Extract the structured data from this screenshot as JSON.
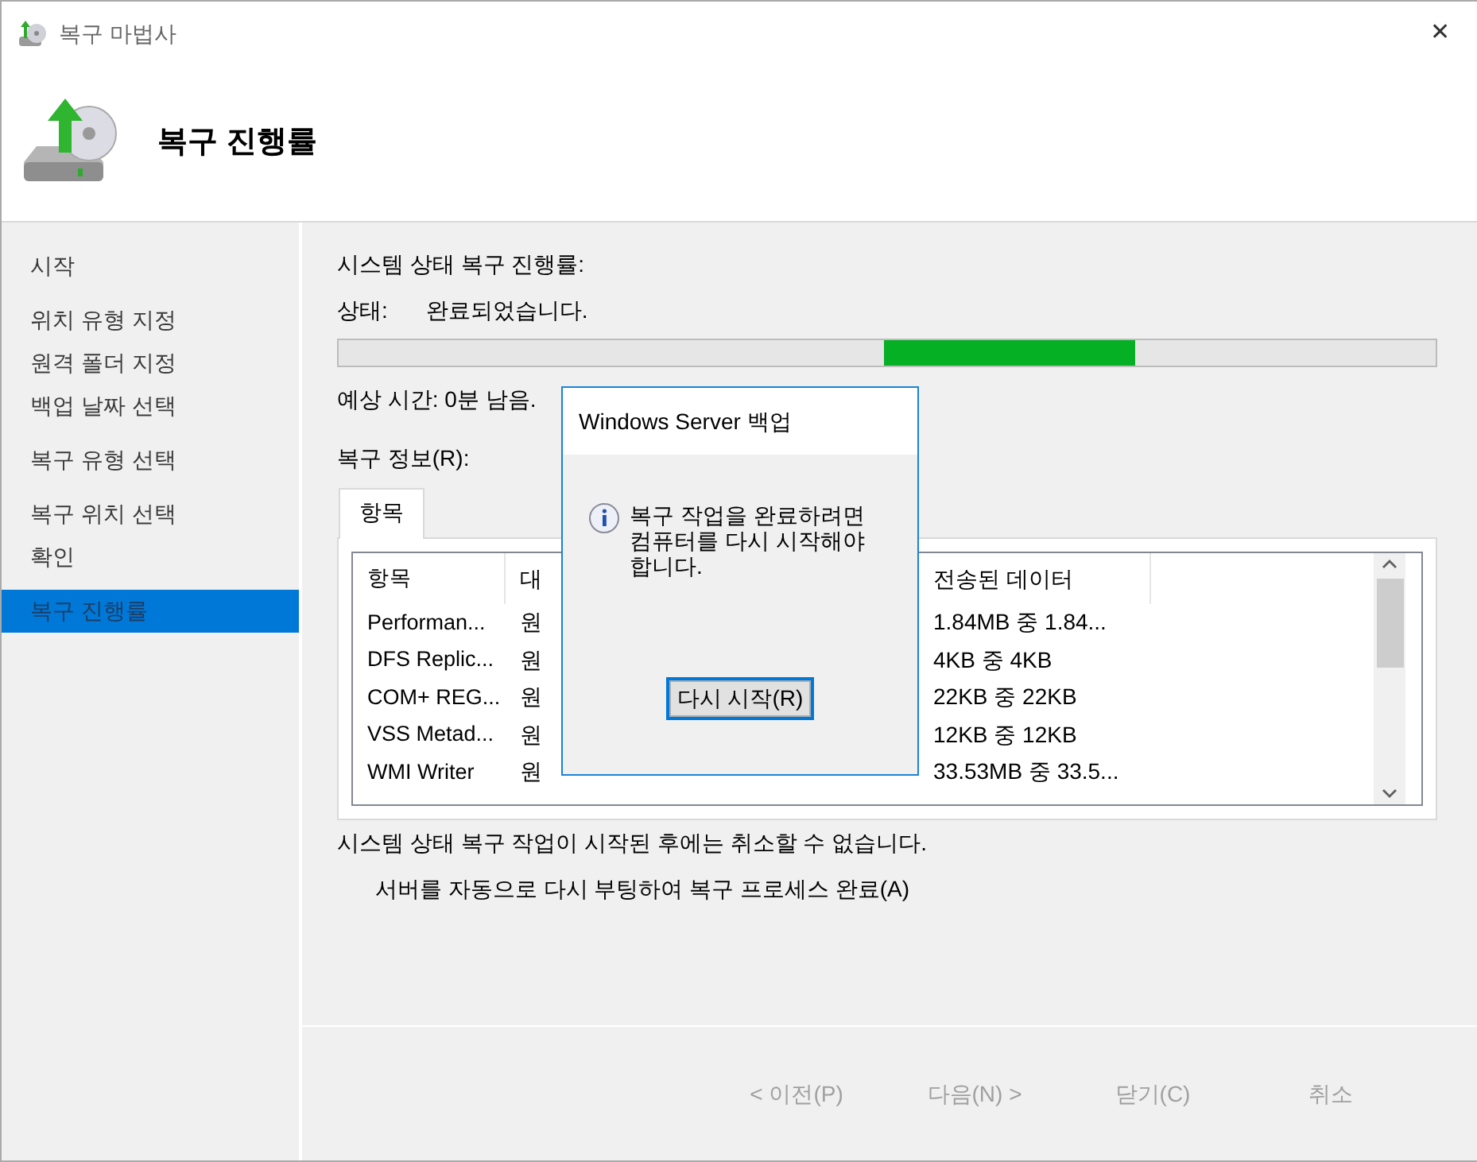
{
  "window": {
    "title": "복구 마법사",
    "close": "✕"
  },
  "header": {
    "title": "복구 진행률"
  },
  "sidebar": {
    "items": [
      {
        "label": "시작",
        "selected": false
      },
      {
        "label": "위치 유형 지정",
        "selected": false
      },
      {
        "label": "원격 폴더 지정",
        "selected": false
      },
      {
        "label": "백업 날짜 선택",
        "selected": false
      },
      {
        "label": "복구 유형 선택",
        "selected": false
      },
      {
        "label": "복구 위치 선택",
        "selected": false
      },
      {
        "label": "확인",
        "selected": false
      },
      {
        "label": "복구 진행률",
        "selected": true
      }
    ]
  },
  "progress": {
    "heading": "시스템 상태 복구 진행률:",
    "status_label": "상태:",
    "status_value": "완료되었습니다.",
    "estimate": "예상 시간: 0분 남음.",
    "indeterminate": true
  },
  "details": {
    "label": "복구 정보(R):",
    "tabs": [
      {
        "label": "항목",
        "selected": true
      }
    ],
    "table": {
      "columns": [
        "항목",
        "대",
        "",
        "전송된 데이터"
      ],
      "rows": [
        {
          "item": "Performan...",
          "target": "원",
          "transferred": "1.84MB 중 1.84..."
        },
        {
          "item": "DFS Replic...",
          "target": "원",
          "transferred": "4KB 중 4KB"
        },
        {
          "item": "COM+ REG...",
          "target": "원",
          "transferred": "22KB 중 22KB"
        },
        {
          "item": "VSS Metad...",
          "target": "원",
          "transferred": "12KB 중 12KB"
        },
        {
          "item": "WMI Writer",
          "target": "원",
          "transferred": "33.53MB 중 33.5..."
        }
      ]
    }
  },
  "note": "시스템 상태 복구 작업이 시작된 후에는 취소할 수 없습니다.",
  "auto_reboot": "서버를 자동으로 다시 부팅하여 복구 프로세스 완료(A)",
  "buttons": [
    {
      "label": "< 이전(P)",
      "disabled": true
    },
    {
      "label": "다음(N) >",
      "disabled": true
    },
    {
      "label": "닫기(C)",
      "disabled": true
    },
    {
      "label": "취소",
      "disabled": true
    }
  ],
  "dialog": {
    "title": "Windows Server 백업",
    "message": "복구 작업을 완료하려면 컴퓨터를 다시 시작해야 합니다.",
    "button": "다시 시작(R)"
  }
}
